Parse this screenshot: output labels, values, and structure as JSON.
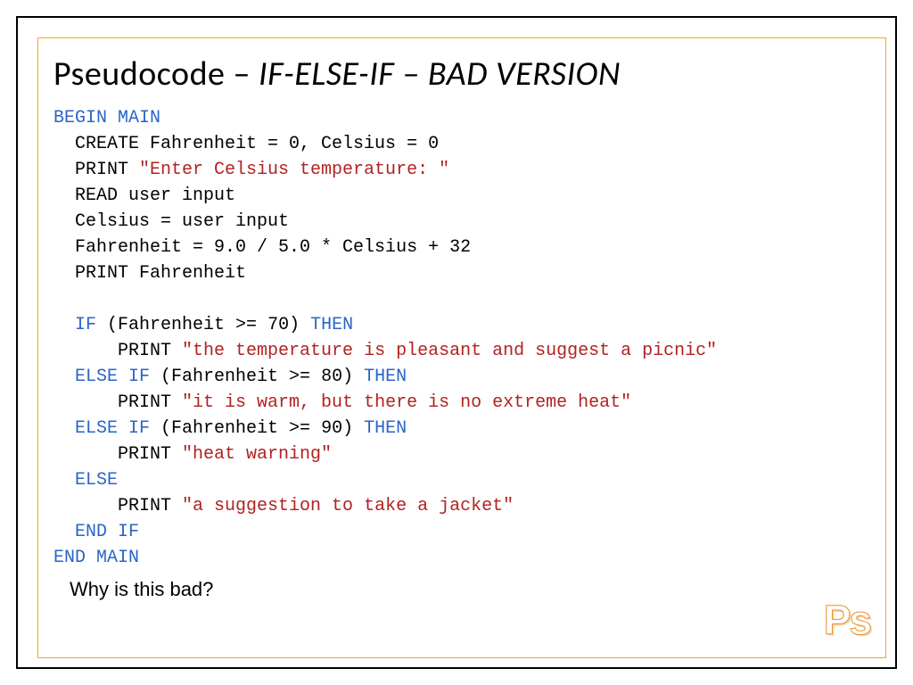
{
  "title": {
    "prefix": "Pseudocode – ",
    "italic": "IF-ELSE-IF – BAD VERSION"
  },
  "code": {
    "l1": "BEGIN MAIN",
    "l2": "  CREATE Fahrenheit = 0, Celsius = 0",
    "l3a": "  PRINT ",
    "l3s": "\"Enter Celsius temperature: \"",
    "l4": "  READ user input",
    "l5": "  Celsius = user input",
    "l6": "  Fahrenheit = 9.0 / 5.0 * Celsius + 32",
    "l7": "  PRINT Fahrenheit",
    "blank1": "",
    "l8a": "  ",
    "l8k1": "IF",
    "l8b": " (Fahrenheit >= 70) ",
    "l8k2": "THEN",
    "l9a": "      PRINT ",
    "l9s": "\"the temperature is pleasant and suggest a picnic\"",
    "l10a": "  ",
    "l10k1": "ELSE IF",
    "l10b": " (Fahrenheit >= 80) ",
    "l10k2": "THEN",
    "l11a": "      PRINT ",
    "l11s": "\"it is warm, but there is no extreme heat\"",
    "l12a": "  ",
    "l12k1": "ELSE IF",
    "l12b": " (Fahrenheit >= 90) ",
    "l12k2": "THEN",
    "l13a": "      PRINT ",
    "l13s": "\"heat warning\"",
    "l14a": "  ",
    "l14k": "ELSE",
    "l15a": "      PRINT ",
    "l15s": "\"a suggestion to take a jacket\"",
    "l16a": "  ",
    "l16k": "END IF",
    "l17": "END MAIN"
  },
  "question": "Why is this bad?",
  "logo": "Ps"
}
